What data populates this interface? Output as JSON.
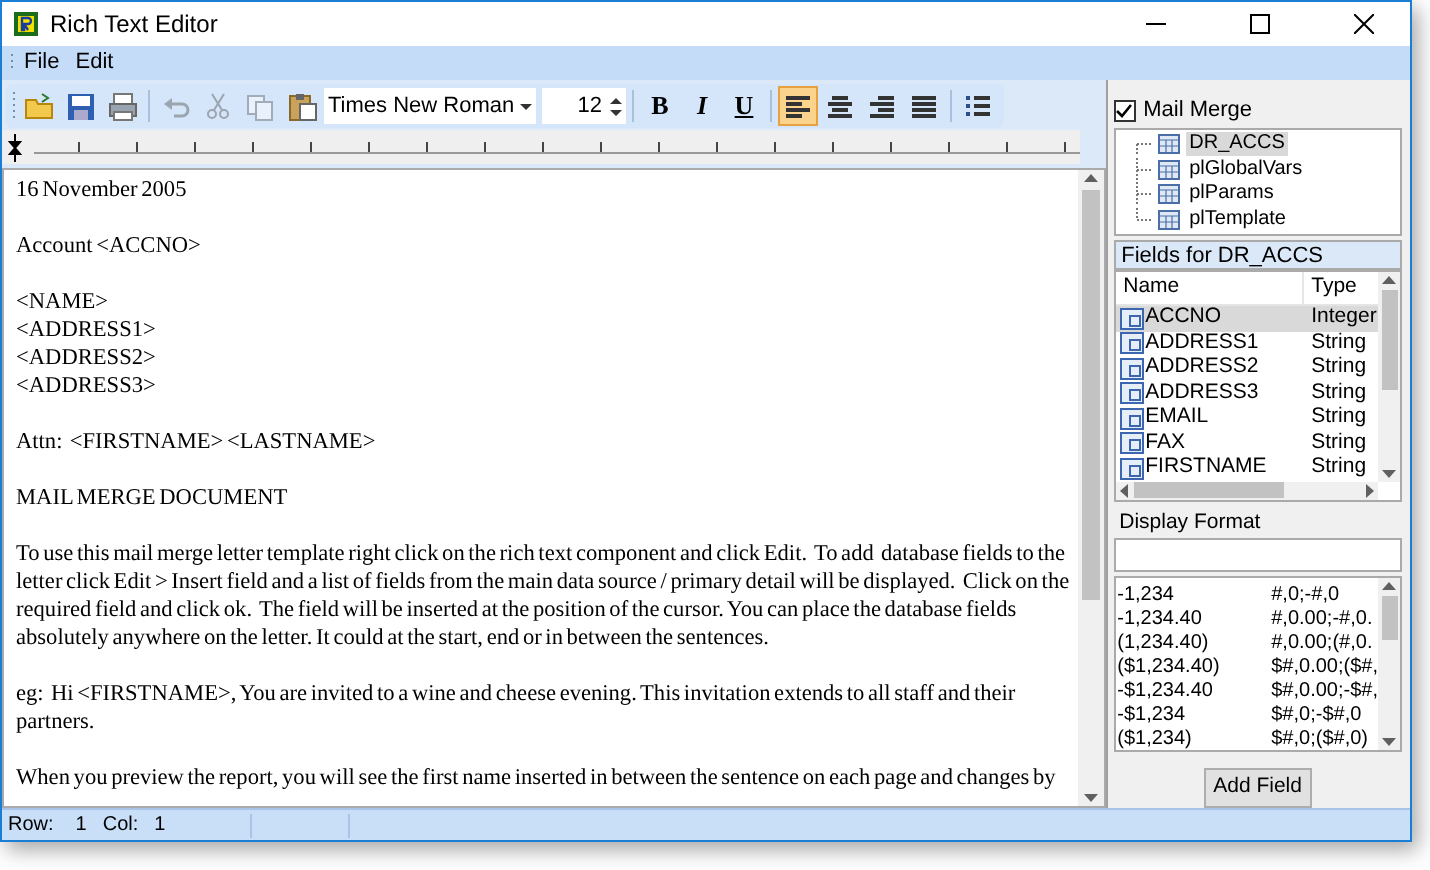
{
  "window": {
    "title": "Rich Text Editor"
  },
  "menu": [
    "File",
    "Edit"
  ],
  "toolbar": {
    "file_buttons": [
      {
        "disabled": false
      },
      {
        "disabled": false
      },
      {
        "disabled": false
      }
    ],
    "edit_buttons": [
      {
        "disabled": true
      },
      {
        "disabled": true
      },
      {
        "disabled": true
      },
      {
        "disabled": false
      }
    ],
    "font": "Times New Roman",
    "size": "12",
    "style_buttons": [
      {
        "label": "B"
      },
      {
        "label": "I"
      },
      {
        "label": "U"
      }
    ],
    "align_buttons": [
      {
        "selected": true
      },
      {
        "selected": false
      },
      {
        "selected": false
      },
      {
        "selected": false
      }
    ]
  },
  "document": {
    "paragraphs": [
      {
        "lines": [
          "16 November 2005"
        ]
      },
      {
        "lines": [
          "Account <ACCNO>"
        ]
      },
      {
        "lines": [
          "<NAME>",
          "<ADDRESS1>",
          "<ADDRESS2>",
          "<ADDRESS3>"
        ]
      },
      {
        "lines": [
          "Attn:  <FIRSTNAME> <LASTNAME>"
        ]
      },
      {
        "lines": [
          "MAIL MERGE DOCUMENT"
        ]
      },
      {
        "lines": [
          "To use this mail merge letter template right click on the rich text component and click Edit.  To add  database fields to the letter click Edit > Insert field and a list of fields from the main data source / primary detail will be displayed.  Click on the required field and click ok.  The field will be inserted at the position of the cursor. You can place the database fields absolutely anywhere on the letter. It could at the start, end or in between the sentences."
        ]
      },
      {
        "lines": [
          "eg:  Hi <FIRSTNAME>, You are invited to a wine and cheese evening. This invitation extends to all staff and their partners."
        ]
      },
      {
        "lines": [
          "When you preview the report, you will see the first name inserted in between the sentence on each page and changes by"
        ]
      }
    ]
  },
  "mail_merge": {
    "label": "Mail Merge",
    "checked": true
  },
  "datasets": [
    {
      "label": "DR_ACCS",
      "selected": true
    },
    {
      "label": "plGlobalVars",
      "selected": false
    },
    {
      "label": "plParams",
      "selected": false
    },
    {
      "label": "plTemplate",
      "selected": false
    }
  ],
  "fields_header": "Fields for DR_ACCS",
  "fields": {
    "columns": [
      "Name",
      "Type"
    ],
    "rows": [
      {
        "name": "ACCNO",
        "type": "Integer",
        "selected": true
      },
      {
        "name": "ADDRESS1",
        "type": "String",
        "selected": false
      },
      {
        "name": "ADDRESS2",
        "type": "String",
        "selected": false
      },
      {
        "name": "ADDRESS3",
        "type": "String",
        "selected": false
      },
      {
        "name": "EMAIL",
        "type": "String",
        "selected": false
      },
      {
        "name": "FAX",
        "type": "String",
        "selected": false
      },
      {
        "name": "FIRSTNAME",
        "type": "String",
        "selected": false
      }
    ]
  },
  "display_format": {
    "label": "Display Format",
    "rows": [
      {
        "example": "-1,234",
        "format": "#,0;-#,0"
      },
      {
        "example": "-1,234.40",
        "format": "#,0.00;-#,0."
      },
      {
        "example": "(1,234.40)",
        "format": "#,0.00;(#,0."
      },
      {
        "example": "($1,234.40)",
        "format": "$#,0.00;($#,"
      },
      {
        "example": "-$1,234.40",
        "format": "$#,0.00;-$#,"
      },
      {
        "example": "-$1,234",
        "format": "$#,0;-$#,0"
      },
      {
        "example": "($1,234)",
        "format": "$#,0;($#,0)"
      }
    ]
  },
  "add_field_button": "Add Field",
  "status_bar": {
    "row_label": "Row:",
    "row": "1",
    "col_label": "Col:",
    "col": "1"
  }
}
